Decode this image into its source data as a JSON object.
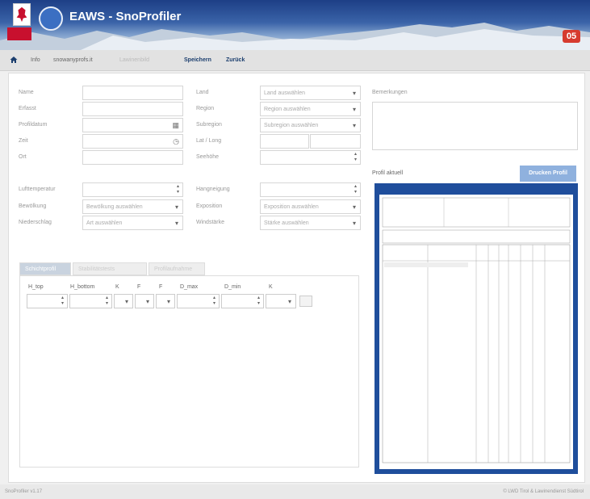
{
  "header": {
    "app_title": "EAWS - SnoProfiler",
    "badge": "05"
  },
  "menu": {
    "info": "Info",
    "site": "snowanyprofs.it",
    "faded": "Lawinenbild",
    "save": "Speichern",
    "back": "Zurück"
  },
  "form": {
    "labels": {
      "name": "Name",
      "author": "Erfasst",
      "date": "Profildatum",
      "time": "Zeit",
      "place": "Ort",
      "country": "Land",
      "region": "Region",
      "subregion": "Subregion",
      "latlong": "Lat / Long",
      "elevation": "Seehöhe",
      "air_temp": "Lufttemperatur",
      "slope_angle": "Hangneigung",
      "cloud": "Bewölkung",
      "exposition": "Exposition",
      "precipitation": "Niederschlag",
      "wind": "Windstärke",
      "remarks": "Bemerkungen"
    },
    "selects": {
      "country": "Land auswählen",
      "region": "Region auswählen",
      "subregion": "Subregion auswählen",
      "cloud": "Bewölkung auswählen",
      "precipitation": "Art auswählen",
      "exposition": "Exposition auswählen",
      "wind": "Stärke auswählen"
    }
  },
  "tabs": {
    "t1": "Schichtprofil",
    "t2": "Stabilitätstests",
    "t3": "Profilaufnahme"
  },
  "table_headers": [
    "H_top",
    "H_bottom",
    "K",
    "F",
    "F",
    "D_max",
    "D_min",
    "K"
  ],
  "preview": {
    "title": "Profil aktuell",
    "button": "Drucken Profil"
  },
  "footer": {
    "left": "SnoProfiler v1.17",
    "right": "© LWD Tirol & Lawinendienst Südtirol"
  },
  "colors": {
    "badge": "#d63b2f",
    "header_dark": "#1d3f86",
    "accent": "#8fb1de"
  }
}
